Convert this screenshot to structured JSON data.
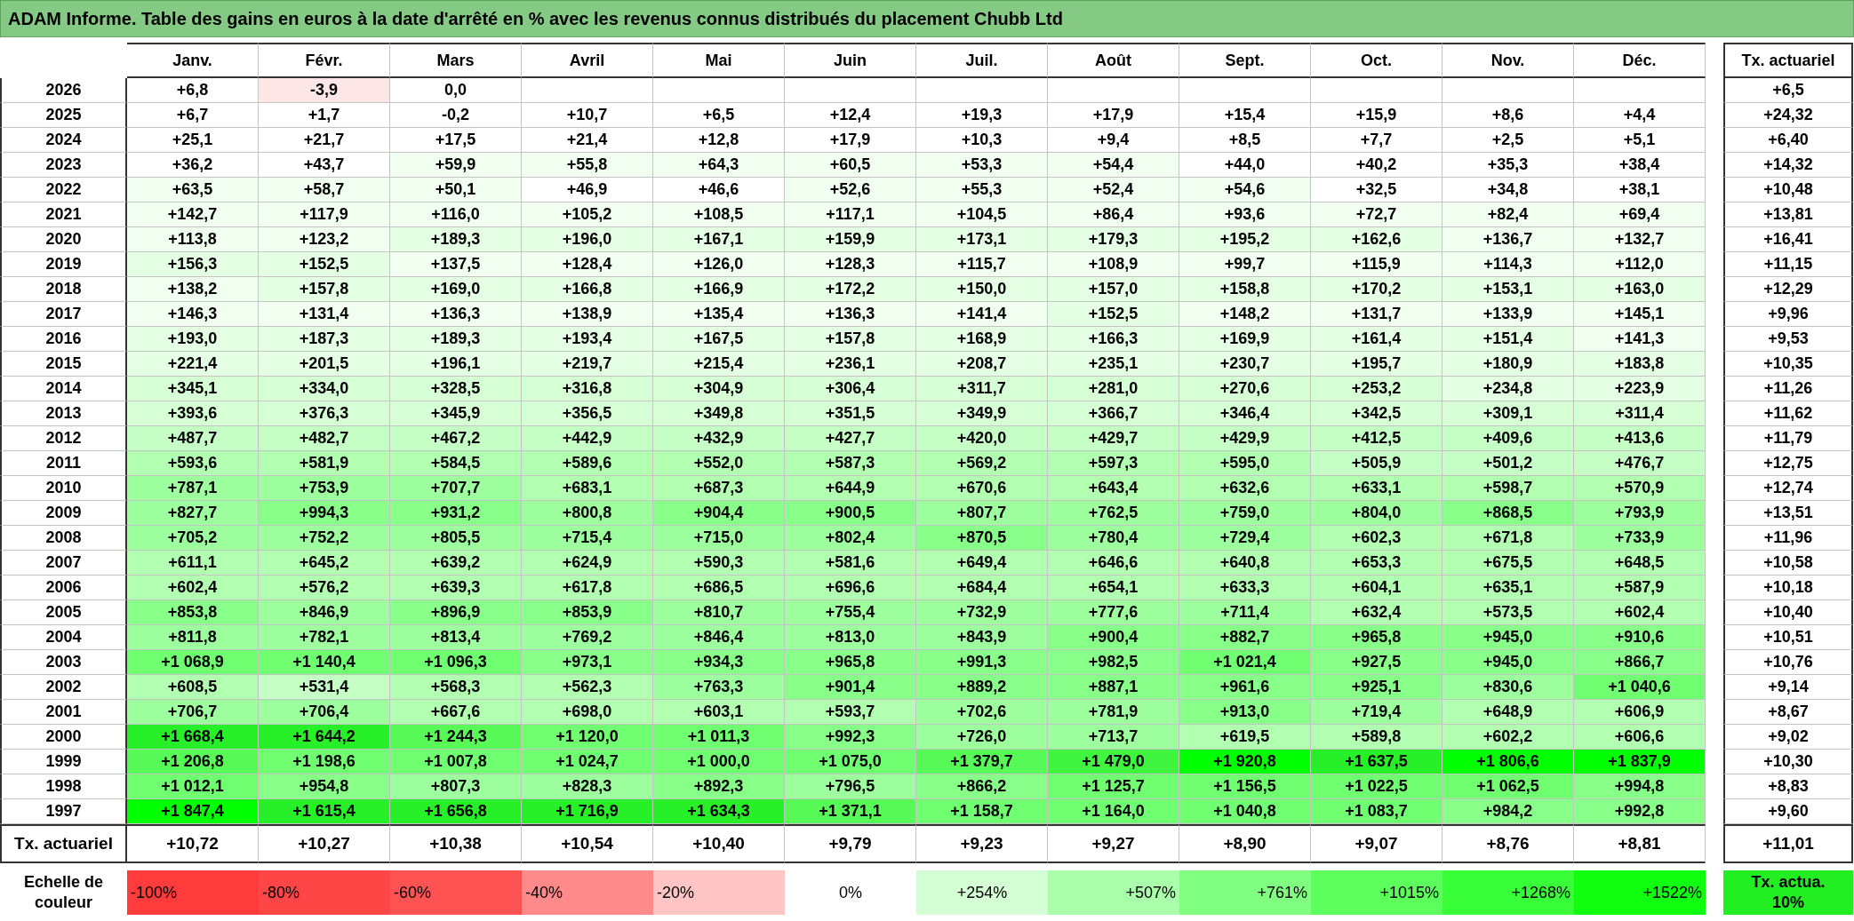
{
  "title": "ADAM Informe. Table des gains en euros à la date d'arrêté en % avec les revenus connus distribués du placement Chubb Ltd",
  "table": {
    "columns": [
      "Janv.",
      "Févr.",
      "Mars",
      "Avril",
      "Mai",
      "Juin",
      "Juil.",
      "Août",
      "Sept.",
      "Oct.",
      "Nov.",
      "Déc."
    ],
    "rate_header": "Tx. actuariel",
    "rows": [
      {
        "year": "2026",
        "cells": [
          {
            "text": "+6,8",
            "color": "#ffffff"
          },
          {
            "text": "-3,9",
            "color": "#fde6e6"
          },
          {
            "text": "0,0",
            "color": "#ffffff"
          }
        ],
        "rate": "+6,5"
      },
      {
        "year": "2025",
        "cells": [
          {
            "text": "+6,7",
            "color": "#ffffff"
          },
          {
            "text": "+1,7",
            "color": "#ffffff"
          },
          {
            "text": "-0,2",
            "color": "#ffffff"
          },
          {
            "text": "+10,7",
            "color": "#ffffff"
          },
          {
            "text": "+6,5",
            "color": "#ffffff"
          },
          {
            "text": "+12,4",
            "color": "#ffffff"
          },
          {
            "text": "+19,3",
            "color": "#ffffff"
          },
          {
            "text": "+17,9",
            "color": "#ffffff"
          },
          {
            "text": "+15,4",
            "color": "#ffffff"
          },
          {
            "text": "+15,9",
            "color": "#ffffff"
          },
          {
            "text": "+8,6",
            "color": "#ffffff"
          },
          {
            "text": "+4,4",
            "color": "#ffffff"
          }
        ],
        "rate": "+24,32"
      },
      {
        "year": "2024",
        "cells": [
          {
            "text": "+25,1",
            "color": "#ffffff"
          },
          {
            "text": "+21,7",
            "color": "#ffffff"
          },
          {
            "text": "+17,5",
            "color": "#ffffff"
          },
          {
            "text": "+21,4",
            "color": "#ffffff"
          },
          {
            "text": "+12,8",
            "color": "#ffffff"
          },
          {
            "text": "+17,9",
            "color": "#ffffff"
          },
          {
            "text": "+10,3",
            "color": "#ffffff"
          },
          {
            "text": "+9,4",
            "color": "#ffffff"
          },
          {
            "text": "+8,5",
            "color": "#ffffff"
          },
          {
            "text": "+7,7",
            "color": "#ffffff"
          },
          {
            "text": "+2,5",
            "color": "#ffffff"
          },
          {
            "text": "+5,1",
            "color": "#ffffff"
          }
        ],
        "rate": "+6,40"
      },
      {
        "year": "2023",
        "cells": [
          {
            "text": "+36,2",
            "color": "#ffffff"
          },
          {
            "text": "+43,7",
            "color": "#ffffff"
          },
          {
            "text": "+59,9",
            "color": "#f0fff0"
          },
          {
            "text": "+55,8",
            "color": "#f0fff0"
          },
          {
            "text": "+64,3",
            "color": "#f0fff0"
          },
          {
            "text": "+60,5",
            "color": "#f0fff0"
          },
          {
            "text": "+53,3",
            "color": "#f0fff0"
          },
          {
            "text": "+54,4",
            "color": "#f0fff0"
          },
          {
            "text": "+44,0",
            "color": "#ffffff"
          },
          {
            "text": "+40,2",
            "color": "#ffffff"
          },
          {
            "text": "+35,3",
            "color": "#ffffff"
          },
          {
            "text": "+38,4",
            "color": "#ffffff"
          }
        ],
        "rate": "+14,32"
      },
      {
        "year": "2022",
        "cells": [
          {
            "text": "+63,5",
            "color": "#f0fff0"
          },
          {
            "text": "+58,7",
            "color": "#f0fff0"
          },
          {
            "text": "+50,1",
            "color": "#f0fff0"
          },
          {
            "text": "+46,9",
            "color": "#ffffff"
          },
          {
            "text": "+46,6",
            "color": "#ffffff"
          },
          {
            "text": "+52,6",
            "color": "#f0fff0"
          },
          {
            "text": "+55,3",
            "color": "#f0fff0"
          },
          {
            "text": "+52,4",
            "color": "#f0fff0"
          },
          {
            "text": "+54,6",
            "color": "#f0fff0"
          },
          {
            "text": "+32,5",
            "color": "#ffffff"
          },
          {
            "text": "+34,8",
            "color": "#ffffff"
          },
          {
            "text": "+38,1",
            "color": "#ffffff"
          }
        ],
        "rate": "+10,48"
      },
      {
        "year": "2021",
        "cells": [
          {
            "text": "+142,7",
            "color": "#f0fff0"
          },
          {
            "text": "+117,9",
            "color": "#f0fff0"
          },
          {
            "text": "+116,0",
            "color": "#f0fff0"
          },
          {
            "text": "+105,2",
            "color": "#f0fff0"
          },
          {
            "text": "+108,5",
            "color": "#f0fff0"
          },
          {
            "text": "+117,1",
            "color": "#f0fff0"
          },
          {
            "text": "+104,5",
            "color": "#f0fff0"
          },
          {
            "text": "+86,4",
            "color": "#f0fff0"
          },
          {
            "text": "+93,6",
            "color": "#f0fff0"
          },
          {
            "text": "+72,7",
            "color": "#f0fff0"
          },
          {
            "text": "+82,4",
            "color": "#f0fff0"
          },
          {
            "text": "+69,4",
            "color": "#f0fff0"
          }
        ],
        "rate": "+13,81"
      },
      {
        "year": "2020",
        "cells": [
          {
            "text": "+113,8",
            "color": "#f0fff0"
          },
          {
            "text": "+123,2",
            "color": "#f0fff0"
          },
          {
            "text": "+189,3",
            "color": "#e4ffe4"
          },
          {
            "text": "+196,0",
            "color": "#e4ffe4"
          },
          {
            "text": "+167,1",
            "color": "#e4ffe4"
          },
          {
            "text": "+159,9",
            "color": "#e4ffe4"
          },
          {
            "text": "+173,1",
            "color": "#e4ffe4"
          },
          {
            "text": "+179,3",
            "color": "#e4ffe4"
          },
          {
            "text": "+195,2",
            "color": "#e4ffe4"
          },
          {
            "text": "+162,6",
            "color": "#e4ffe4"
          },
          {
            "text": "+136,7",
            "color": "#f0fff0"
          },
          {
            "text": "+132,7",
            "color": "#f0fff0"
          }
        ],
        "rate": "+16,41"
      },
      {
        "year": "2019",
        "cells": [
          {
            "text": "+156,3",
            "color": "#e4ffe4"
          },
          {
            "text": "+152,5",
            "color": "#e4ffe4"
          },
          {
            "text": "+137,5",
            "color": "#f0fff0"
          },
          {
            "text": "+128,4",
            "color": "#f0fff0"
          },
          {
            "text": "+126,0",
            "color": "#f0fff0"
          },
          {
            "text": "+128,3",
            "color": "#f0fff0"
          },
          {
            "text": "+115,7",
            "color": "#f0fff0"
          },
          {
            "text": "+108,9",
            "color": "#f0fff0"
          },
          {
            "text": "+99,7",
            "color": "#f0fff0"
          },
          {
            "text": "+115,9",
            "color": "#f0fff0"
          },
          {
            "text": "+114,3",
            "color": "#f0fff0"
          },
          {
            "text": "+112,0",
            "color": "#f0fff0"
          }
        ],
        "rate": "+11,15"
      },
      {
        "year": "2018",
        "cells": [
          {
            "text": "+138,2",
            "color": "#f0fff0"
          },
          {
            "text": "+157,8",
            "color": "#e4ffe4"
          },
          {
            "text": "+169,0",
            "color": "#e4ffe4"
          },
          {
            "text": "+166,8",
            "color": "#e4ffe4"
          },
          {
            "text": "+166,9",
            "color": "#e4ffe4"
          },
          {
            "text": "+172,2",
            "color": "#e4ffe4"
          },
          {
            "text": "+150,0",
            "color": "#e4ffe4"
          },
          {
            "text": "+157,0",
            "color": "#e4ffe4"
          },
          {
            "text": "+158,8",
            "color": "#e4ffe4"
          },
          {
            "text": "+170,2",
            "color": "#e4ffe4"
          },
          {
            "text": "+153,1",
            "color": "#e4ffe4"
          },
          {
            "text": "+163,0",
            "color": "#e4ffe4"
          }
        ],
        "rate": "+12,29"
      },
      {
        "year": "2017",
        "cells": [
          {
            "text": "+146,3",
            "color": "#f0fff0"
          },
          {
            "text": "+131,4",
            "color": "#f0fff0"
          },
          {
            "text": "+136,3",
            "color": "#f0fff0"
          },
          {
            "text": "+138,9",
            "color": "#f0fff0"
          },
          {
            "text": "+135,4",
            "color": "#f0fff0"
          },
          {
            "text": "+136,3",
            "color": "#f0fff0"
          },
          {
            "text": "+141,4",
            "color": "#f0fff0"
          },
          {
            "text": "+152,5",
            "color": "#e4ffe4"
          },
          {
            "text": "+148,2",
            "color": "#f0fff0"
          },
          {
            "text": "+131,7",
            "color": "#f0fff0"
          },
          {
            "text": "+133,9",
            "color": "#f0fff0"
          },
          {
            "text": "+145,1",
            "color": "#f0fff0"
          }
        ],
        "rate": "+9,96"
      },
      {
        "year": "2016",
        "cells": [
          {
            "text": "+193,0",
            "color": "#e4ffe4"
          },
          {
            "text": "+187,3",
            "color": "#e4ffe4"
          },
          {
            "text": "+189,3",
            "color": "#e4ffe4"
          },
          {
            "text": "+193,4",
            "color": "#e4ffe4"
          },
          {
            "text": "+167,5",
            "color": "#e4ffe4"
          },
          {
            "text": "+157,8",
            "color": "#e4ffe4"
          },
          {
            "text": "+168,9",
            "color": "#e4ffe4"
          },
          {
            "text": "+166,3",
            "color": "#e4ffe4"
          },
          {
            "text": "+169,9",
            "color": "#e4ffe4"
          },
          {
            "text": "+161,4",
            "color": "#e4ffe4"
          },
          {
            "text": "+151,4",
            "color": "#e4ffe4"
          },
          {
            "text": "+141,3",
            "color": "#f0fff0"
          }
        ],
        "rate": "+9,53"
      },
      {
        "year": "2015",
        "cells": [
          {
            "text": "+221,4",
            "color": "#e4ffe4"
          },
          {
            "text": "+201,5",
            "color": "#e4ffe4"
          },
          {
            "text": "+196,1",
            "color": "#e4ffe4"
          },
          {
            "text": "+219,7",
            "color": "#e4ffe4"
          },
          {
            "text": "+215,4",
            "color": "#e4ffe4"
          },
          {
            "text": "+236,1",
            "color": "#e4ffe4"
          },
          {
            "text": "+208,7",
            "color": "#e4ffe4"
          },
          {
            "text": "+235,1",
            "color": "#e4ffe4"
          },
          {
            "text": "+230,7",
            "color": "#e4ffe4"
          },
          {
            "text": "+195,7",
            "color": "#e4ffe4"
          },
          {
            "text": "+180,9",
            "color": "#e4ffe4"
          },
          {
            "text": "+183,8",
            "color": "#e4ffe4"
          }
        ],
        "rate": "+10,35"
      },
      {
        "year": "2014",
        "cells": [
          {
            "text": "+345,1",
            "color": "#d6ffd6"
          },
          {
            "text": "+334,0",
            "color": "#d6ffd6"
          },
          {
            "text": "+328,5",
            "color": "#d6ffd6"
          },
          {
            "text": "+316,8",
            "color": "#d6ffd6"
          },
          {
            "text": "+304,9",
            "color": "#d6ffd6"
          },
          {
            "text": "+306,4",
            "color": "#d6ffd6"
          },
          {
            "text": "+311,7",
            "color": "#d6ffd6"
          },
          {
            "text": "+281,0",
            "color": "#d6ffd6"
          },
          {
            "text": "+270,6",
            "color": "#d6ffd6"
          },
          {
            "text": "+253,2",
            "color": "#d6ffd6"
          },
          {
            "text": "+234,8",
            "color": "#e4ffe4"
          },
          {
            "text": "+223,9",
            "color": "#e4ffe4"
          }
        ],
        "rate": "+11,26"
      },
      {
        "year": "2013",
        "cells": [
          {
            "text": "+393,6",
            "color": "#d6ffd6"
          },
          {
            "text": "+376,3",
            "color": "#d6ffd6"
          },
          {
            "text": "+345,9",
            "color": "#d6ffd6"
          },
          {
            "text": "+356,5",
            "color": "#d6ffd6"
          },
          {
            "text": "+349,8",
            "color": "#d6ffd6"
          },
          {
            "text": "+351,5",
            "color": "#d6ffd6"
          },
          {
            "text": "+349,9",
            "color": "#d6ffd6"
          },
          {
            "text": "+366,7",
            "color": "#d6ffd6"
          },
          {
            "text": "+346,4",
            "color": "#d6ffd6"
          },
          {
            "text": "+342,5",
            "color": "#d6ffd6"
          },
          {
            "text": "+309,1",
            "color": "#d6ffd6"
          },
          {
            "text": "+311,4",
            "color": "#d6ffd6"
          }
        ],
        "rate": "+11,62"
      },
      {
        "year": "2012",
        "cells": [
          {
            "text": "+487,7",
            "color": "#c6ffc6"
          },
          {
            "text": "+482,7",
            "color": "#c6ffc6"
          },
          {
            "text": "+467,2",
            "color": "#c6ffc6"
          },
          {
            "text": "+442,9",
            "color": "#c6ffc6"
          },
          {
            "text": "+432,9",
            "color": "#c6ffc6"
          },
          {
            "text": "+427,7",
            "color": "#c6ffc6"
          },
          {
            "text": "+420,0",
            "color": "#c6ffc6"
          },
          {
            "text": "+429,7",
            "color": "#c6ffc6"
          },
          {
            "text": "+429,9",
            "color": "#c6ffc6"
          },
          {
            "text": "+412,5",
            "color": "#c6ffc6"
          },
          {
            "text": "+409,6",
            "color": "#c6ffc6"
          },
          {
            "text": "+413,6",
            "color": "#c6ffc6"
          }
        ],
        "rate": "+11,79"
      },
      {
        "year": "2011",
        "cells": [
          {
            "text": "+593,6",
            "color": "#b2ffb2"
          },
          {
            "text": "+581,9",
            "color": "#b2ffb2"
          },
          {
            "text": "+584,5",
            "color": "#b2ffb2"
          },
          {
            "text": "+589,6",
            "color": "#b2ffb2"
          },
          {
            "text": "+552,0",
            "color": "#b2ffb2"
          },
          {
            "text": "+587,3",
            "color": "#b2ffb2"
          },
          {
            "text": "+569,2",
            "color": "#b2ffb2"
          },
          {
            "text": "+597,3",
            "color": "#b2ffb2"
          },
          {
            "text": "+595,0",
            "color": "#b2ffb2"
          },
          {
            "text": "+505,9",
            "color": "#c6ffc6"
          },
          {
            "text": "+501,2",
            "color": "#c6ffc6"
          },
          {
            "text": "+476,7",
            "color": "#c6ffc6"
          }
        ],
        "rate": "+12,75"
      },
      {
        "year": "2010",
        "cells": [
          {
            "text": "+787,1",
            "color": "#9eff9e"
          },
          {
            "text": "+753,9",
            "color": "#9eff9e"
          },
          {
            "text": "+707,7",
            "color": "#9eff9e"
          },
          {
            "text": "+683,1",
            "color": "#b2ffb2"
          },
          {
            "text": "+687,3",
            "color": "#b2ffb2"
          },
          {
            "text": "+644,9",
            "color": "#b2ffb2"
          },
          {
            "text": "+670,6",
            "color": "#b2ffb2"
          },
          {
            "text": "+643,4",
            "color": "#b2ffb2"
          },
          {
            "text": "+632,6",
            "color": "#b2ffb2"
          },
          {
            "text": "+633,1",
            "color": "#b2ffb2"
          },
          {
            "text": "+598,7",
            "color": "#b2ffb2"
          },
          {
            "text": "+570,9",
            "color": "#b2ffb2"
          }
        ],
        "rate": "+12,74"
      },
      {
        "year": "2009",
        "cells": [
          {
            "text": "+827,7",
            "color": "#9eff9e"
          },
          {
            "text": "+994,3",
            "color": "#88ff88"
          },
          {
            "text": "+931,2",
            "color": "#88ff88"
          },
          {
            "text": "+800,8",
            "color": "#9eff9e"
          },
          {
            "text": "+904,4",
            "color": "#88ff88"
          },
          {
            "text": "+900,5",
            "color": "#88ff88"
          },
          {
            "text": "+807,7",
            "color": "#9eff9e"
          },
          {
            "text": "+762,5",
            "color": "#9eff9e"
          },
          {
            "text": "+759,0",
            "color": "#9eff9e"
          },
          {
            "text": "+804,0",
            "color": "#9eff9e"
          },
          {
            "text": "+868,5",
            "color": "#88ff88"
          },
          {
            "text": "+793,9",
            "color": "#9eff9e"
          }
        ],
        "rate": "+13,51"
      },
      {
        "year": "2008",
        "cells": [
          {
            "text": "+705,2",
            "color": "#9eff9e"
          },
          {
            "text": "+752,2",
            "color": "#9eff9e"
          },
          {
            "text": "+805,5",
            "color": "#9eff9e"
          },
          {
            "text": "+715,4",
            "color": "#9eff9e"
          },
          {
            "text": "+715,0",
            "color": "#9eff9e"
          },
          {
            "text": "+802,4",
            "color": "#9eff9e"
          },
          {
            "text": "+870,5",
            "color": "#88ff88"
          },
          {
            "text": "+780,4",
            "color": "#9eff9e"
          },
          {
            "text": "+729,4",
            "color": "#9eff9e"
          },
          {
            "text": "+602,3",
            "color": "#b2ffb2"
          },
          {
            "text": "+671,8",
            "color": "#b2ffb2"
          },
          {
            "text": "+733,9",
            "color": "#9eff9e"
          }
        ],
        "rate": "+11,96"
      },
      {
        "year": "2007",
        "cells": [
          {
            "text": "+611,1",
            "color": "#b2ffb2"
          },
          {
            "text": "+645,2",
            "color": "#b2ffb2"
          },
          {
            "text": "+639,2",
            "color": "#b2ffb2"
          },
          {
            "text": "+624,9",
            "color": "#b2ffb2"
          },
          {
            "text": "+590,3",
            "color": "#b2ffb2"
          },
          {
            "text": "+581,6",
            "color": "#b2ffb2"
          },
          {
            "text": "+649,4",
            "color": "#b2ffb2"
          },
          {
            "text": "+646,6",
            "color": "#b2ffb2"
          },
          {
            "text": "+640,8",
            "color": "#b2ffb2"
          },
          {
            "text": "+653,3",
            "color": "#b2ffb2"
          },
          {
            "text": "+675,5",
            "color": "#b2ffb2"
          },
          {
            "text": "+648,5",
            "color": "#b2ffb2"
          }
        ],
        "rate": "+10,58"
      },
      {
        "year": "2006",
        "cells": [
          {
            "text": "+602,4",
            "color": "#b2ffb2"
          },
          {
            "text": "+576,2",
            "color": "#b2ffb2"
          },
          {
            "text": "+639,3",
            "color": "#b2ffb2"
          },
          {
            "text": "+617,8",
            "color": "#b2ffb2"
          },
          {
            "text": "+686,5",
            "color": "#b2ffb2"
          },
          {
            "text": "+696,6",
            "color": "#b2ffb2"
          },
          {
            "text": "+684,4",
            "color": "#b2ffb2"
          },
          {
            "text": "+654,1",
            "color": "#b2ffb2"
          },
          {
            "text": "+633,3",
            "color": "#b2ffb2"
          },
          {
            "text": "+604,1",
            "color": "#b2ffb2"
          },
          {
            "text": "+635,1",
            "color": "#b2ffb2"
          },
          {
            "text": "+587,9",
            "color": "#b2ffb2"
          }
        ],
        "rate": "+10,18"
      },
      {
        "year": "2005",
        "cells": [
          {
            "text": "+853,8",
            "color": "#88ff88"
          },
          {
            "text": "+846,9",
            "color": "#9eff9e"
          },
          {
            "text": "+896,9",
            "color": "#88ff88"
          },
          {
            "text": "+853,9",
            "color": "#88ff88"
          },
          {
            "text": "+810,7",
            "color": "#9eff9e"
          },
          {
            "text": "+755,4",
            "color": "#9eff9e"
          },
          {
            "text": "+732,9",
            "color": "#9eff9e"
          },
          {
            "text": "+777,6",
            "color": "#9eff9e"
          },
          {
            "text": "+711,4",
            "color": "#9eff9e"
          },
          {
            "text": "+632,4",
            "color": "#b2ffb2"
          },
          {
            "text": "+573,5",
            "color": "#b2ffb2"
          },
          {
            "text": "+602,4",
            "color": "#b2ffb2"
          }
        ],
        "rate": "+10,40"
      },
      {
        "year": "2004",
        "cells": [
          {
            "text": "+811,8",
            "color": "#9eff9e"
          },
          {
            "text": "+782,1",
            "color": "#9eff9e"
          },
          {
            "text": "+813,4",
            "color": "#9eff9e"
          },
          {
            "text": "+769,2",
            "color": "#9eff9e"
          },
          {
            "text": "+846,4",
            "color": "#9eff9e"
          },
          {
            "text": "+813,0",
            "color": "#9eff9e"
          },
          {
            "text": "+843,9",
            "color": "#9eff9e"
          },
          {
            "text": "+900,4",
            "color": "#88ff88"
          },
          {
            "text": "+882,7",
            "color": "#88ff88"
          },
          {
            "text": "+965,8",
            "color": "#88ff88"
          },
          {
            "text": "+945,0",
            "color": "#88ff88"
          },
          {
            "text": "+910,6",
            "color": "#88ff88"
          }
        ],
        "rate": "+10,51"
      },
      {
        "year": "2003",
        "cells": [
          {
            "text": "+1 068,9",
            "color": "#70ff70"
          },
          {
            "text": "+1 140,4",
            "color": "#70ff70"
          },
          {
            "text": "+1 096,3",
            "color": "#70ff70"
          },
          {
            "text": "+973,1",
            "color": "#88ff88"
          },
          {
            "text": "+934,3",
            "color": "#88ff88"
          },
          {
            "text": "+965,8",
            "color": "#88ff88"
          },
          {
            "text": "+991,3",
            "color": "#88ff88"
          },
          {
            "text": "+982,5",
            "color": "#88ff88"
          },
          {
            "text": "+1 021,4",
            "color": "#70ff70"
          },
          {
            "text": "+927,5",
            "color": "#88ff88"
          },
          {
            "text": "+945,0",
            "color": "#88ff88"
          },
          {
            "text": "+866,7",
            "color": "#88ff88"
          }
        ],
        "rate": "+10,76"
      },
      {
        "year": "2002",
        "cells": [
          {
            "text": "+608,5",
            "color": "#b2ffb2"
          },
          {
            "text": "+531,4",
            "color": "#c6ffc6"
          },
          {
            "text": "+568,3",
            "color": "#b2ffb2"
          },
          {
            "text": "+562,3",
            "color": "#b2ffb2"
          },
          {
            "text": "+763,3",
            "color": "#9eff9e"
          },
          {
            "text": "+901,4",
            "color": "#88ff88"
          },
          {
            "text": "+889,2",
            "color": "#88ff88"
          },
          {
            "text": "+887,1",
            "color": "#88ff88"
          },
          {
            "text": "+961,6",
            "color": "#88ff88"
          },
          {
            "text": "+925,1",
            "color": "#88ff88"
          },
          {
            "text": "+830,6",
            "color": "#9eff9e"
          },
          {
            "text": "+1 040,6",
            "color": "#70ff70"
          }
        ],
        "rate": "+9,14"
      },
      {
        "year": "2001",
        "cells": [
          {
            "text": "+706,7",
            "color": "#9eff9e"
          },
          {
            "text": "+706,4",
            "color": "#9eff9e"
          },
          {
            "text": "+667,6",
            "color": "#b2ffb2"
          },
          {
            "text": "+698,0",
            "color": "#b2ffb2"
          },
          {
            "text": "+603,1",
            "color": "#b2ffb2"
          },
          {
            "text": "+593,7",
            "color": "#b2ffb2"
          },
          {
            "text": "+702,6",
            "color": "#9eff9e"
          },
          {
            "text": "+781,9",
            "color": "#9eff9e"
          },
          {
            "text": "+913,0",
            "color": "#88ff88"
          },
          {
            "text": "+719,4",
            "color": "#9eff9e"
          },
          {
            "text": "+648,9",
            "color": "#b2ffb2"
          },
          {
            "text": "+606,9",
            "color": "#b2ffb2"
          }
        ],
        "rate": "+8,67"
      },
      {
        "year": "2000",
        "cells": [
          {
            "text": "+1 668,4",
            "color": "#28f028"
          },
          {
            "text": "+1 644,2",
            "color": "#28f028"
          },
          {
            "text": "+1 244,3",
            "color": "#58fa58"
          },
          {
            "text": "+1 120,0",
            "color": "#70ff70"
          },
          {
            "text": "+1 011,3",
            "color": "#70ff70"
          },
          {
            "text": "+992,3",
            "color": "#88ff88"
          },
          {
            "text": "+726,0",
            "color": "#9eff9e"
          },
          {
            "text": "+713,7",
            "color": "#9eff9e"
          },
          {
            "text": "+619,5",
            "color": "#b2ffb2"
          },
          {
            "text": "+589,8",
            "color": "#b2ffb2"
          },
          {
            "text": "+602,2",
            "color": "#b2ffb2"
          },
          {
            "text": "+606,6",
            "color": "#b2ffb2"
          }
        ],
        "rate": "+9,02"
      },
      {
        "year": "1999",
        "cells": [
          {
            "text": "+1 206,8",
            "color": "#58fa58"
          },
          {
            "text": "+1 198,6",
            "color": "#70ff70"
          },
          {
            "text": "+1 007,8",
            "color": "#70ff70"
          },
          {
            "text": "+1 024,7",
            "color": "#70ff70"
          },
          {
            "text": "+1 000,0",
            "color": "#70ff70"
          },
          {
            "text": "+1 075,0",
            "color": "#70ff70"
          },
          {
            "text": "+1 379,7",
            "color": "#58fa58"
          },
          {
            "text": "+1 479,0",
            "color": "#40f440"
          },
          {
            "text": "+1 920,8",
            "color": "#00ff00"
          },
          {
            "text": "+1 637,5",
            "color": "#28f028"
          },
          {
            "text": "+1 806,6",
            "color": "#00ff00"
          },
          {
            "text": "+1 837,9",
            "color": "#00ff00"
          }
        ],
        "rate": "+10,30"
      },
      {
        "year": "1998",
        "cells": [
          {
            "text": "+1 012,1",
            "color": "#70ff70"
          },
          {
            "text": "+954,8",
            "color": "#88ff88"
          },
          {
            "text": "+807,3",
            "color": "#9eff9e"
          },
          {
            "text": "+828,3",
            "color": "#9eff9e"
          },
          {
            "text": "+892,3",
            "color": "#88ff88"
          },
          {
            "text": "+796,5",
            "color": "#9eff9e"
          },
          {
            "text": "+866,2",
            "color": "#88ff88"
          },
          {
            "text": "+1 125,7",
            "color": "#70ff70"
          },
          {
            "text": "+1 156,5",
            "color": "#70ff70"
          },
          {
            "text": "+1 022,5",
            "color": "#70ff70"
          },
          {
            "text": "+1 062,5",
            "color": "#70ff70"
          },
          {
            "text": "+994,8",
            "color": "#88ff88"
          }
        ],
        "rate": "+8,83"
      },
      {
        "year": "1997",
        "cells": [
          {
            "text": "+1 847,4",
            "color": "#00ff00"
          },
          {
            "text": "+1 615,4",
            "color": "#28f028"
          },
          {
            "text": "+1 656,8",
            "color": "#28f028"
          },
          {
            "text": "+1 716,9",
            "color": "#28f028"
          },
          {
            "text": "+1 634,3",
            "color": "#28f028"
          },
          {
            "text": "+1 371,1",
            "color": "#58fa58"
          },
          {
            "text": "+1 158,7",
            "color": "#70ff70"
          },
          {
            "text": "+1 164,0",
            "color": "#70ff70"
          },
          {
            "text": "+1 040,8",
            "color": "#70ff70"
          },
          {
            "text": "+1 083,7",
            "color": "#70ff70"
          },
          {
            "text": "+984,2",
            "color": "#88ff88"
          },
          {
            "text": "+992,8",
            "color": "#88ff88"
          }
        ],
        "rate": "+9,60"
      }
    ],
    "total": {
      "label": "Tx. actuariel",
      "cells": [
        "+10,72",
        "+10,27",
        "+10,38",
        "+10,54",
        "+10,40",
        "+9,79",
        "+9,23",
        "+9,27",
        "+8,90",
        "+9,07",
        "+8,76",
        "+8,81"
      ],
      "rate": "+11,01"
    }
  },
  "legend": {
    "label": "Echelle de couleur",
    "steps": [
      {
        "text": "-100%",
        "color": "#ff3b3b"
      },
      {
        "text": "-80%",
        "color": "#ff4646"
      },
      {
        "text": "-60%",
        "color": "#ff5252"
      },
      {
        "text": "-40%",
        "color": "#ff8a8a"
      },
      {
        "text": "-20%",
        "color": "#ffc4c4"
      },
      {
        "text": "0%",
        "color": "#ffffff"
      },
      {
        "text": "+254%",
        "color": "#d4ffd4"
      },
      {
        "text": "+507%",
        "color": "#aaffaa"
      },
      {
        "text": "+761%",
        "color": "#80ff80"
      },
      {
        "text": "+1015%",
        "color": "#5cff5c"
      },
      {
        "text": "+1268%",
        "color": "#38ff38"
      },
      {
        "text": "+1522%",
        "color": "#10ff10"
      }
    ],
    "rate_box": {
      "text": "Tx. actua. 10%",
      "color": "#22ee22"
    }
  }
}
